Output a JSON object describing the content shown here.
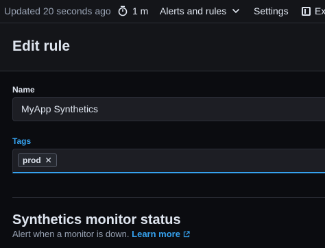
{
  "topbar": {
    "updated": "Updated 20 seconds ago",
    "refresh_interval": "1 m",
    "alerts_menu": "Alerts and rules",
    "settings": "Settings",
    "explore": "Ex"
  },
  "page": {
    "title": "Edit rule"
  },
  "form": {
    "name_label": "Name",
    "name_value": "MyApp Synthetics",
    "tags_label": "Tags",
    "tags": [
      "prod"
    ],
    "tag_remove_glyph": "✕"
  },
  "rule_type": {
    "title": "Synthetics monitor status",
    "description": "Alert when a monitor is down.",
    "learn_more": "Learn more"
  },
  "colors": {
    "accent": "#36a2ef",
    "background": "#0b0c10"
  }
}
